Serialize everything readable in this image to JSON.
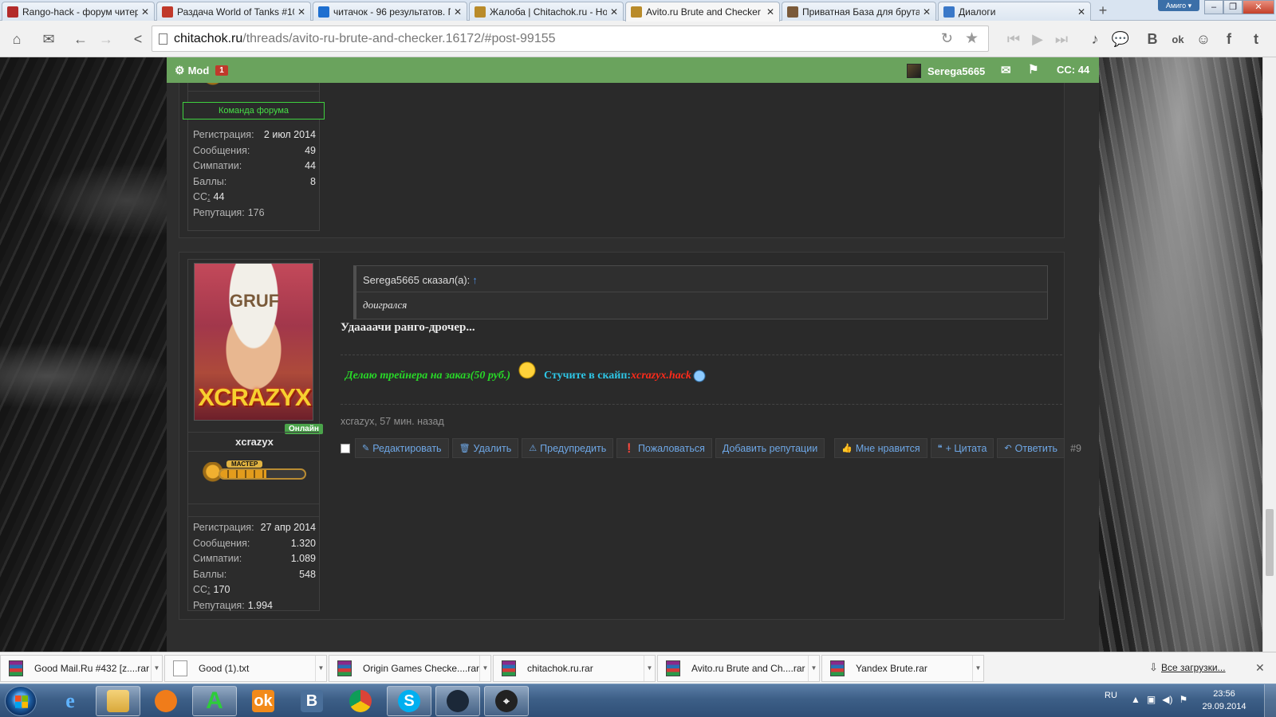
{
  "browser": {
    "tabs": [
      {
        "label": "Rango-hack - форум читер",
        "fav": "#b32b2b"
      },
      {
        "label": "Раздача World of Tanks #10",
        "fav": "#c0392b"
      },
      {
        "label": "читачок - 96 результатов. П",
        "fav": "#1e6fd0"
      },
      {
        "label": "Жалоба | Chitachok.ru - Но",
        "fav": "#b98b2a"
      },
      {
        "label": "Avito.ru Brute and Checker |",
        "fav": "#b98b2a"
      },
      {
        "label": "Приватная База для брута |",
        "fav": "#7a5a3a"
      },
      {
        "label": "Диалоги",
        "fav": "#3a78c8"
      }
    ],
    "amigo_label": "Амиго ▾",
    "url_domain": "chitachok.ru",
    "url_path": "/threads/avito-ru-brute-and-checker.16172/#post-99155",
    "social_labels": {
      "music": "♪",
      "chat": "💬",
      "vk": "B",
      "ok": "ok",
      "friends": "☺",
      "fb": "f",
      "tw": "t"
    }
  },
  "forum": {
    "nav": {
      "mod_label": "Mod",
      "mod_count": "1",
      "username": "Serega5665",
      "cc_label": "CC: 44"
    },
    "post_prev": {
      "team_badge": "Команда форума",
      "stats": [
        {
          "k": "Регистрация:",
          "v": "2 июл 2014"
        },
        {
          "k": "Сообщения:",
          "v": "49"
        },
        {
          "k": "Симпатии:",
          "v": "44"
        },
        {
          "k": "Баллы:",
          "v": "8"
        }
      ],
      "cc_label": "СС",
      "cc_sep": ":",
      "cc_value": "44",
      "rep_label": "Репутация:",
      "rep_value": "176"
    },
    "post": {
      "avatar_text": "XCRAZYX",
      "avatar_top": "GRUF",
      "online_label": "Онлайн",
      "username": "xcrazyx",
      "rank_name": "МАСТЕР",
      "rank_progress": 0.55,
      "stats": [
        {
          "k": "Регистрация:",
          "v": "27 апр 2014"
        },
        {
          "k": "Сообщения:",
          "v": "1.320"
        },
        {
          "k": "Симпатии:",
          "v": "1.089"
        },
        {
          "k": "Баллы:",
          "v": "548"
        }
      ],
      "cc_label": "СС",
      "cc_sep": ":",
      "cc_value": "170",
      "rep_label": "Репутация:",
      "rep_value": "1.994",
      "quote_author": "Serega5665 сказал(а):",
      "quote_arrow": "↑",
      "quote_text": "доигрался",
      "message": "Удаааачи ранго-дрочер...",
      "sig_part1": "Делаю трейнера на заказ(50 руб.)",
      "sig_part2": "Стучите в скайп:",
      "sig_part3": "xcrazyx.hack",
      "meta": "xcrazyx, 57 мин. назад",
      "actions": [
        {
          "icon": "✎",
          "label": "Редактировать",
          "name": "edit-button"
        },
        {
          "icon": "🗑",
          "label": "Удалить",
          "name": "delete-button"
        },
        {
          "icon": "⚠",
          "label": "Предупредить",
          "name": "warn-button"
        },
        {
          "icon": "❗",
          "label": "Пожаловаться",
          "name": "report-button"
        },
        {
          "icon": "",
          "label": "Добавить репутации",
          "name": "add-reputation-button"
        }
      ],
      "actions_right": [
        {
          "icon": "👍",
          "label": "Мне нравится",
          "name": "like-button"
        },
        {
          "icon": "❝",
          "label": "+ Цитата",
          "name": "quote-button"
        },
        {
          "icon": "↶",
          "label": "Ответить",
          "name": "reply-button"
        }
      ],
      "post_number": "#9"
    }
  },
  "downloads": {
    "items": [
      "Good Mail.Ru #432 [z....rar",
      "Good (1).txt",
      "Origin Games Checke....rar",
      "chitachok.ru.rar",
      "Avito.ru Brute and Ch....rar",
      "Yandex Brute.rar"
    ],
    "all_label": "Все загрузки..."
  },
  "taskbar": {
    "lang": "RU",
    "time": "23:56",
    "date": "29.09.2014"
  }
}
